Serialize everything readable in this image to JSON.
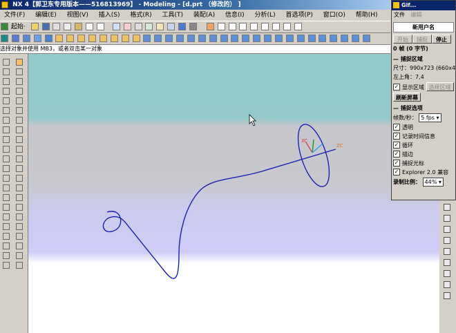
{
  "window": {
    "title": "NX 4【郭卫东专用版本——516813969】 - Modeling - [d.prt （修改的） ]"
  },
  "menu": [
    "文件(F)",
    "编辑(E)",
    "视图(V)",
    "插入(S)",
    "格式(R)",
    "工具(T)",
    "装配(A)",
    "信息(I)",
    "分析(L)",
    "首选项(P)",
    "窗口(O)",
    "帮助(H)"
  ],
  "toolbar": {
    "start_label": "起始·"
  },
  "prompt": {
    "text": "选择对象并使用 MB3，或者双击某一对象"
  },
  "viewport": {
    "axis_label_x": "XC",
    "axis_label_z": "ZC",
    "colors": {
      "bg_top": "#93c9c9",
      "bg_mid": "#c6c6cc",
      "bg_low": "#cfccf7",
      "bg_bottom": "#ffffff",
      "curve": "#1a20b4"
    }
  },
  "gif_panel": {
    "title": "Gif...",
    "menu": [
      "文件",
      "编辑"
    ],
    "user": "新用户名",
    "buttons": {
      "start": "开始",
      "capture": "捕捉",
      "stop": "停止"
    },
    "frames": "0 帧 (0 字节)",
    "capture_area_header": "捕捉区域",
    "size_text": "尺寸：990x723 (660x482)",
    "top_left_text": "左上角：7,4",
    "show_area_label": "显示区域",
    "select_area_button": "选择区域",
    "refresh_button": "刷新屏幕",
    "options_header": "捕捉选项",
    "fps_label": "帧数/秒：",
    "fps_value": "5 fps",
    "options": [
      "透明",
      "记录时间信息",
      "循环",
      "描边",
      "捕捉光标",
      "Explorer 2.0 兼容"
    ],
    "ratio_label": "录制比例：",
    "ratio_value": "44%"
  }
}
